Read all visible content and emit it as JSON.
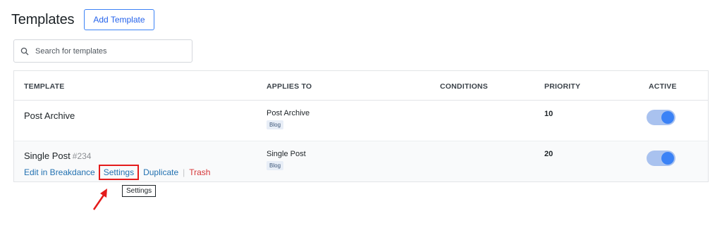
{
  "header": {
    "title": "Templates",
    "add_button": "Add Template"
  },
  "search": {
    "placeholder": "Search for templates",
    "icon": "search-icon"
  },
  "table": {
    "columns": [
      "TEMPLATE",
      "APPLIES TO",
      "CONDITIONS",
      "PRIORITY",
      "ACTIVE"
    ],
    "rows": [
      {
        "name": "Post Archive",
        "id": "",
        "applies_to": "Post Archive",
        "badge": "Blog",
        "conditions": "",
        "priority": "10",
        "active": true
      },
      {
        "name": "Single Post",
        "id": "#234",
        "applies_to": "Single Post",
        "badge": "Blog",
        "conditions": "",
        "priority": "20",
        "active": true
      }
    ],
    "row_actions": {
      "edit": "Edit in Breakdance",
      "settings": "Settings",
      "duplicate": "Duplicate",
      "separator": "|",
      "trash": "Trash"
    }
  },
  "tooltip": {
    "text": "Settings"
  },
  "colors": {
    "accent": "#3b82f6",
    "toggle_track": "#a9c2ef",
    "highlight": "#e41b1b",
    "trash": "#d63638"
  }
}
